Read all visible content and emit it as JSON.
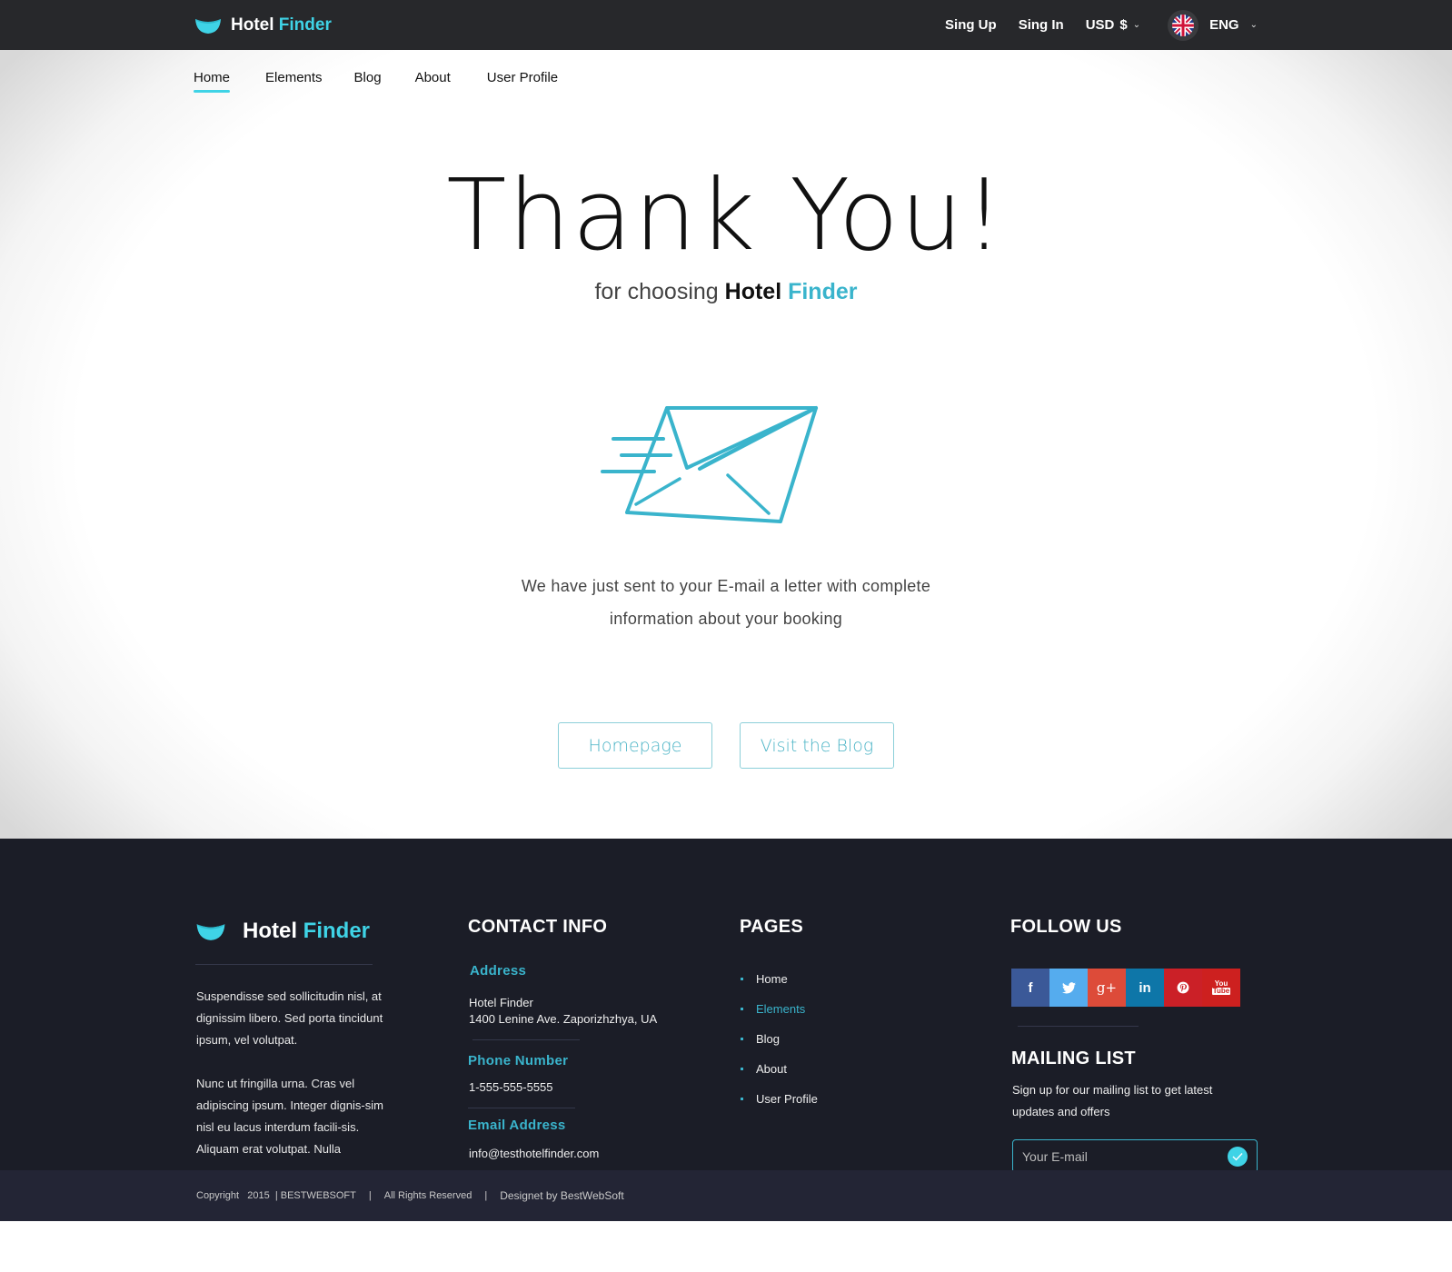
{
  "header": {
    "brand_primary": "Hotel",
    "brand_accent": "Finder",
    "sign_up": "Sing Up",
    "sign_in": "Sing In",
    "currency": "USD",
    "currency_symbol": "$",
    "language": "ENG",
    "flag_icon": "uk-flag-icon"
  },
  "nav": {
    "items": [
      {
        "label": "Home",
        "active": true
      },
      {
        "label": "Elements",
        "active": false
      },
      {
        "label": "Blog",
        "active": false
      },
      {
        "label": "About",
        "active": false
      },
      {
        "label": "User Profile",
        "active": false
      }
    ]
  },
  "hero": {
    "title": "Thank You!",
    "subtitle_prefix": "for choosing",
    "subtitle_brand": "Hotel",
    "subtitle_accent": "Finder",
    "icon": "sent-envelope-icon",
    "message_line1": "We have just sent to your E-mail a letter with complete",
    "message_line2": "information about your booking",
    "buttons": {
      "homepage": "Homepage",
      "blog": "Visit the Blog"
    }
  },
  "footer": {
    "brand_primary": "Hotel",
    "brand_accent": "Finder",
    "about_p1": "Suspendisse sed sollicitudin nisl, at dignissim libero. Sed porta tincidunt ipsum, vel volutpat.",
    "about_p2": "Nunc ut fringilla urna. Cras vel adipiscing ipsum. Integer dignis-sim nisl eu lacus interdum facili-sis. Aliquam erat volutpat. Nulla",
    "contact": {
      "heading": "CONTACT INFO",
      "address_label": "Address",
      "address_line1": "Hotel Finder",
      "address_line2": "1400 Lenine Ave. Zaporizhzhya, UA",
      "phone_label": "Phone Number",
      "phone": "1-555-555-5555",
      "email_label": "Email Address",
      "email": "info@testhotelfinder.com"
    },
    "pages": {
      "heading": "PAGES",
      "items": [
        {
          "label": "Home",
          "active": false
        },
        {
          "label": "Elements",
          "active": true
        },
        {
          "label": "Blog",
          "active": false
        },
        {
          "label": "About",
          "active": false
        },
        {
          "label": "User Profile",
          "active": false
        }
      ]
    },
    "follow": {
      "heading": "FOLLOW US",
      "networks": [
        {
          "name": "facebook",
          "glyph": "f",
          "color": "#3b5998"
        },
        {
          "name": "twitter",
          "glyph": "t",
          "color": "#55acee"
        },
        {
          "name": "google-plus",
          "glyph": "g+",
          "color": "#dd4b39"
        },
        {
          "name": "linkedin",
          "glyph": "in",
          "color": "#0e76a8"
        },
        {
          "name": "pinterest",
          "glyph": "p",
          "color": "#cb2027"
        },
        {
          "name": "youtube",
          "glyph": "You",
          "color": "#cd201f"
        }
      ]
    },
    "mailing": {
      "heading": "MAILING LIST",
      "text": "Sign up for our mailing list to get latest updates and offers",
      "placeholder": "Your E-mail"
    },
    "bottom": {
      "copyright": "Copyright   2015  | BESTWEBSOFT",
      "rights": "All Rights Reserved",
      "designer": "Designet by BestWebSoft"
    }
  },
  "colors": {
    "accent": "#3fd3e6",
    "accent_dark": "#3ab4cc",
    "topbar": "#27282b",
    "footer": "#1b1d27",
    "footer_bottom": "#232535"
  }
}
